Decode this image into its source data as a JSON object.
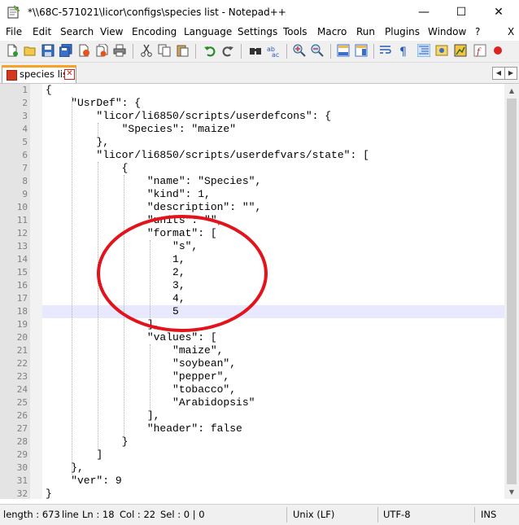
{
  "window": {
    "title": "*\\\\68C-571021\\licor\\configs\\species list - Notepad++",
    "minimize_glyph": "—",
    "maximize_glyph": "☐",
    "close_glyph": "✕"
  },
  "menu": {
    "items": [
      "File",
      "Edit",
      "Search",
      "View",
      "Encoding",
      "Language",
      "Settings",
      "Tools",
      "Macro",
      "Run",
      "Plugins",
      "Window",
      "?"
    ],
    "close_doc_glyph": "X"
  },
  "toolbar": {
    "icons": [
      "new-file",
      "open-file",
      "save",
      "save-all",
      "close",
      "close-all",
      "print",
      "cut",
      "copy",
      "paste",
      "undo",
      "redo",
      "find",
      "replace",
      "zoom-in",
      "zoom-out",
      "sync-vertical",
      "sync-horizontal",
      "word-wrap",
      "show-all-chars",
      "indent-guide",
      "udl",
      "doc-map",
      "function-list",
      "macro-record"
    ]
  },
  "tabs": [
    {
      "label": "species list",
      "active": true,
      "close_glyph": "✕"
    }
  ],
  "tab_scroll": {
    "left": "◀",
    "right": "▶"
  },
  "editor": {
    "current_line": 18,
    "lines": [
      {
        "n": "1",
        "text": "{"
      },
      {
        "n": "2",
        "text": "    \"UsrDef\": {"
      },
      {
        "n": "3",
        "text": "        \"licor/li6850/scripts/userdefcons\": {"
      },
      {
        "n": "4",
        "text": "            \"Species\": \"maize\""
      },
      {
        "n": "5",
        "text": "        },"
      },
      {
        "n": "6",
        "text": "        \"licor/li6850/scripts/userdefvars/state\": ["
      },
      {
        "n": "7",
        "text": "            {"
      },
      {
        "n": "8",
        "text": "                \"name\": \"Species\","
      },
      {
        "n": "9",
        "text": "                \"kind\": 1,"
      },
      {
        "n": "10",
        "text": "                \"description\": \"\","
      },
      {
        "n": "11",
        "text": "                \"units\": \"\","
      },
      {
        "n": "12",
        "text": "                \"format\": ["
      },
      {
        "n": "13",
        "text": "                    \"s\","
      },
      {
        "n": "14",
        "text": "                    1,"
      },
      {
        "n": "15",
        "text": "                    2,"
      },
      {
        "n": "16",
        "text": "                    3,"
      },
      {
        "n": "17",
        "text": "                    4,"
      },
      {
        "n": "18",
        "text": "                    5"
      },
      {
        "n": "19",
        "text": "                ],"
      },
      {
        "n": "20",
        "text": "                \"values\": ["
      },
      {
        "n": "21",
        "text": "                    \"maize\","
      },
      {
        "n": "22",
        "text": "                    \"soybean\","
      },
      {
        "n": "23",
        "text": "                    \"pepper\","
      },
      {
        "n": "24",
        "text": "                    \"tobacco\","
      },
      {
        "n": "25",
        "text": "                    \"Arabidopsis\""
      },
      {
        "n": "26",
        "text": "                ],"
      },
      {
        "n": "27",
        "text": "                \"header\": false"
      },
      {
        "n": "28",
        "text": "            }"
      },
      {
        "n": "29",
        "text": "        ]"
      },
      {
        "n": "30",
        "text": "    },"
      },
      {
        "n": "31",
        "text": "    \"ver\": 9"
      },
      {
        "n": "32",
        "text": "}"
      }
    ]
  },
  "status": {
    "length": "length : 673",
    "lines_label": "line",
    "ln": "Ln : 18",
    "col": "Col : 22",
    "sel": "Sel : 0 | 0",
    "eol": "Unix (LF)",
    "encoding": "UTF-8",
    "mode": "INS"
  },
  "colors": {
    "annotation_circle": "#e3121b",
    "current_line_bg": "#e8e8ff",
    "tab_accent": "#f6a229"
  }
}
